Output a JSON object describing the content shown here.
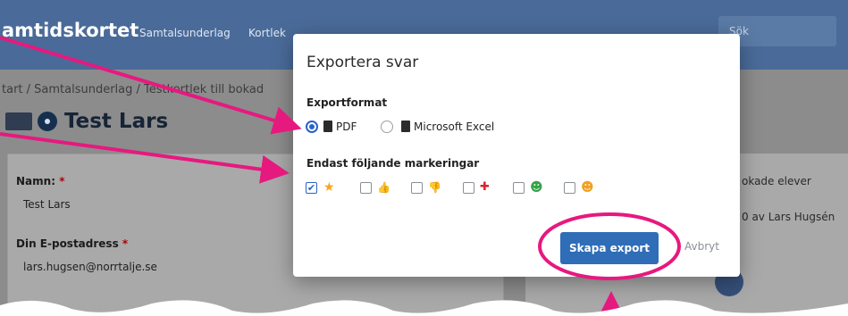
{
  "navbar": {
    "brand": "amtidskortet",
    "links": [
      "Samtalsunderlag",
      "Kortlek"
    ],
    "search_placeholder": "Sök"
  },
  "breadcrumb": "tart / Samtalsunderlag / Testkortlek till bokad",
  "page": {
    "title": "Test Lars",
    "fields": [
      {
        "label": "Namn:",
        "value": "Test Lars"
      },
      {
        "label": "Din E-postadress",
        "value": "lars.hugsen@norrtalje.se"
      }
    ],
    "right_lines": [
      "okade elever",
      "0 av Lars Hugsén"
    ]
  },
  "modal": {
    "title": "Exportera svar",
    "format_label": "Exportformat",
    "format_options": [
      {
        "label": "PDF",
        "icon": "file-pdf-icon",
        "selected": true
      },
      {
        "label": "Microsoft Excel",
        "icon": "file-excel-icon",
        "selected": false
      }
    ],
    "markings_label": "Endast följande markeringar",
    "markings": [
      {
        "icon": "star-icon",
        "glyph": "★",
        "color": "#f5a623",
        "checked": true
      },
      {
        "icon": "thumbs-up-icon",
        "glyph": "👍",
        "color": "#2f5fa8",
        "checked": false
      },
      {
        "icon": "thumbs-down-icon",
        "glyph": "👎",
        "color": "#2f5fa8",
        "checked": false
      },
      {
        "icon": "pin-icon",
        "glyph": "📌",
        "color": "#e0202a",
        "checked": false
      },
      {
        "icon": "smile-icon",
        "glyph": "☻",
        "color": "#35a348",
        "checked": false
      },
      {
        "icon": "neutral-face-icon",
        "glyph": "☻",
        "color": "#f0a020",
        "checked": false
      }
    ],
    "export_button": "Skapa export",
    "cancel_button": "Avbryt"
  },
  "annotation_color": "#e6197f"
}
